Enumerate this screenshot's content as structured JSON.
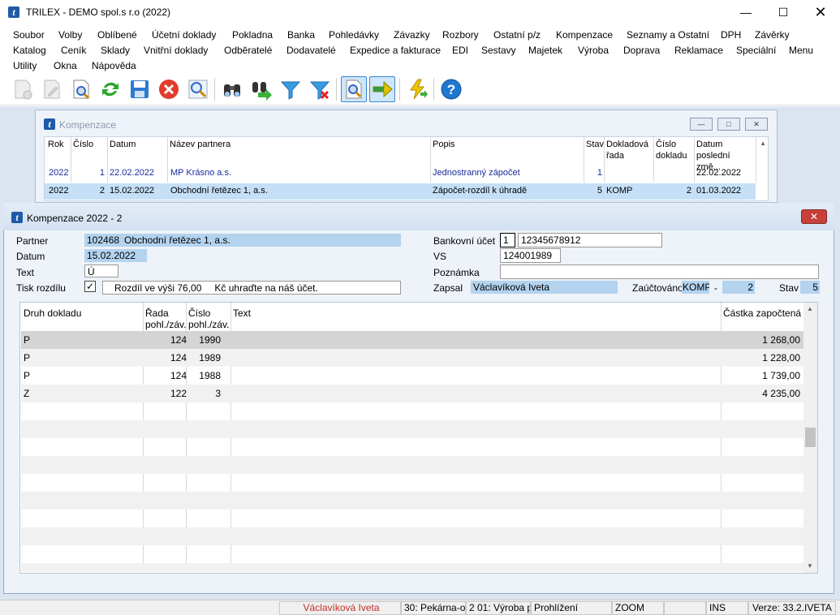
{
  "app": {
    "title": "TRILEX - DEMO spol.s r.o (2022)"
  },
  "menu": [
    "Soubor",
    "Volby",
    "Oblíbené",
    "Účetní doklady",
    "Pokladna",
    "Banka",
    "Pohledávky",
    "Závazky",
    "Rozbory",
    "Ostatní p/z",
    "Kompenzace",
    "Seznamy a Ostatní",
    "DPH",
    "Závěrky",
    "Katalog",
    "Ceník",
    "Sklady",
    "Vnitřní doklady",
    "Odběratelé",
    "Dodavatelé",
    "Expedice a fakturace",
    "EDI",
    "Sestavy",
    "Majetek",
    "Výroba",
    "Doprava",
    "Reklamace",
    "Speciální",
    "Menu",
    "Utility",
    "Okna",
    "Nápověda"
  ],
  "toolbar": [
    "new-doc-icon",
    "edit-doc-icon",
    "view-doc-icon",
    "refresh-icon",
    "save-icon",
    "cancel-icon",
    "search-icon",
    "binoculars-icon",
    "binoculars-next-icon",
    "filter-icon",
    "filter-clear-icon",
    "preview-icon",
    "next-arrow-icon",
    "flash-icon",
    "help-icon"
  ],
  "list_window": {
    "title": "Kompenzace",
    "columns": [
      "Rok",
      "Číslo",
      "Datum",
      "Název partnera",
      "Popis",
      "Stav",
      "Dokladová řada",
      "Číslo dokladu",
      "Datum poslední změ..."
    ],
    "rows": [
      [
        "2022",
        "1",
        "22.02.2022",
        "MP Krásno a.s.",
        "Jednostranný zápočet",
        "1",
        "",
        "",
        "22.02.2022"
      ],
      [
        "2022",
        "2",
        "15.02.2022",
        "Obchodní řetězec 1, a.s.",
        "Zápočet-rozdíl k úhradě",
        "5",
        "KOMP",
        "2",
        "01.03.2022"
      ]
    ]
  },
  "detail": {
    "title": "Kompenzace 2022 - 2",
    "partner_label": "Partner",
    "partner_code": "102468",
    "partner_name": "Obchodní řetězec 1, a.s.",
    "date_label": "Datum",
    "date": "15.02.2022",
    "text_label": "Text",
    "text": "Ú",
    "tisk_label": "Tisk rozdílu",
    "tisk_text": "Rozdíl ve výši 76,00",
    "tisk_text2": "Kč uhraďte na náš účet.",
    "bank_label": "Bankovní účet",
    "bank_code": "1",
    "bank_account": "12345678912",
    "vs_label": "VS",
    "vs": "124001989",
    "note_label": "Poznámka",
    "note": "",
    "zapsal_label": "Zapsal",
    "zapsal": "Václavíková Iveta",
    "zauct_label": "Zaúčtováno",
    "zauct_rada": "KOMP",
    "zauct_dash": "-",
    "zauct_num": "2",
    "stav_label": "Stav",
    "stav": "5",
    "grid_headers": [
      "Druh dokladu",
      "Řada pohl./záv.",
      "Číslo pohl./záv.",
      "Text",
      "Částka započtená"
    ],
    "grid_rows": [
      [
        "P",
        "124",
        "1990",
        "",
        "1 268,00"
      ],
      [
        "P",
        "124",
        "1989",
        "",
        "1 228,00"
      ],
      [
        "P",
        "124",
        "1988",
        "",
        "1 739,00"
      ],
      [
        "Z",
        "122",
        "3",
        "",
        "4 235,00"
      ]
    ]
  },
  "status": [
    "",
    "Václavíková Iveta",
    "30: Pekárna-ob",
    "2 01: Výroba pe",
    "Prohlížení",
    "",
    "ZOOM",
    "",
    "INS",
    "Verze: 33.2.IVETA"
  ]
}
